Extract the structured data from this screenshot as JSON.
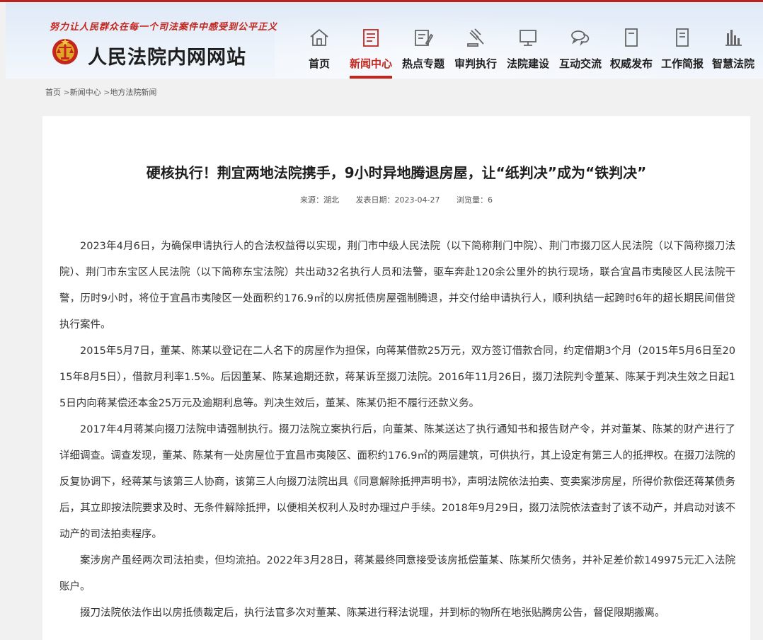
{
  "header": {
    "slogan": "努力让人民群众在每一个司法案件中感受到公平正义",
    "site_title": "人民法院内网网站",
    "accent_color": "#c4251d"
  },
  "nav": {
    "items": [
      {
        "label": "首页",
        "icon": "home-icon",
        "active": false
      },
      {
        "label": "新闻中心",
        "icon": "newspaper-icon",
        "active": true
      },
      {
        "label": "热点专题",
        "icon": "document-edit-icon",
        "active": false
      },
      {
        "label": "审判执行",
        "icon": "gavel-icon",
        "active": false
      },
      {
        "label": "法院建设",
        "icon": "monitor-icon",
        "active": false
      },
      {
        "label": "互动交流",
        "icon": "chat-bubbles-icon",
        "active": false
      },
      {
        "label": "权威发布",
        "icon": "document-icon",
        "active": false
      },
      {
        "label": "工作简报",
        "icon": "report-icon",
        "active": false
      },
      {
        "label": "智慧法院",
        "icon": "bar-chart-icon",
        "active": false
      }
    ]
  },
  "breadcrumb": {
    "home": "首页",
    "news": "新闻中心",
    "current": "地方法院新闻",
    "separator": ">"
  },
  "article": {
    "title": "硬核执行！荆宜两地法院携手，9小时异地腾退房屋，让“纸判决”成为“铁判决”",
    "source": "来源：湖北",
    "date": "发表日期：2023-04-27",
    "views": "浏览量：6",
    "paragraphs": [
      "2023年4月6日，为确保申请执行人的合法权益得以实现，荆门市中级人民法院（以下简称荆门中院）、荆门市掇刀区人民法院（以下简称掇刀法院）、荆门市东宝区人民法院（以下简称东宝法院）共出动32名执行人员和法警，驱车奔赴120余公里外的执行现场，联合宜昌市夷陵区人民法院干警，历时9小时，将位于宜昌市夷陵区一处面积约176.9㎡的以房抵债房屋强制腾退，并交付给申请执行人，顺利执结一起跨时6年的超长期民间借贷执行案件。",
      "2015年5月7日，董某、陈某以登记在二人名下的房屋作为担保，向蒋某借款25万元，双方签订借款合同，约定借期3个月（2015年5月6日至2015年8月5日），借款月利率1.5%。后因董某、陈某逾期还款，蒋某诉至掇刀法院。2016年11月26日，掇刀法院判令董某、陈某于判决生效之日起15日内向蒋某偿还本金25万元及逾期利息等。判决生效后，董某、陈某仍拒不履行还款义务。",
      "2017年4月蒋某向掇刀法院申请强制执行。掇刀法院立案执行后，向董某、陈某送达了执行通知书和报告财产令，并对董某、陈某的财产进行了详细调查。调查发现，董某、陈某有一处房屋位于宜昌市夷陵区、面积约176.9㎡的两层建筑，可供执行，其上设定有第三人的抵押权。在掇刀法院的反复协调下，经蒋某与该第三人协商，该第三人向掇刀法院出具《同意解除抵押声明书》，声明法院依法拍卖、变卖案涉房屋，所得价款偿还蒋某债务后，其立即按法院要求及时、无条件解除抵押，以便相关权利人及时办理过户手续。2018年9月29日，掇刀法院依法查封了该不动产，并启动对该不动产的司法拍卖程序。",
      "案涉房产虽经两次司法拍卖，但均流拍。2022年3月28日，蒋某最终同意接受该房抵偿董某、陈某所欠债务，并补足差价款149975元汇入法院账户。",
      "掇刀法院依法作出以房抵债裁定后，执行法官多次对董某、陈某进行释法说理，并到标的物所在地张贴腾房公告，督促限期搬离。"
    ]
  }
}
